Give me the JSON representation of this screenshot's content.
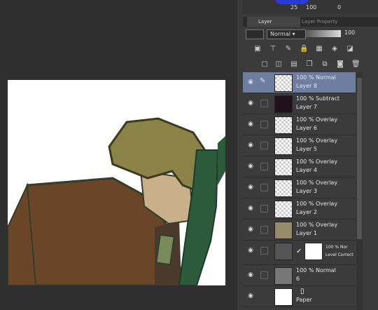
{
  "top": {
    "zoom": "25",
    "value2": "100",
    "value3": "0"
  },
  "tabs": {
    "layer": "Layer",
    "layer_property": "Layer Property"
  },
  "blend": {
    "mode": "Normal",
    "opacity": "100"
  },
  "layers": [
    {
      "pct": "100 % Normal",
      "name": "Layer 8",
      "thumb": "checker",
      "selected": true
    },
    {
      "pct": "100 % Subtract",
      "name": "Layer 7",
      "thumb": "#22111c"
    },
    {
      "pct": "100 % Overlay",
      "name": "Layer 6",
      "thumb": "checker"
    },
    {
      "pct": "100 % Overlay",
      "name": "Layer 5",
      "thumb": "checker"
    },
    {
      "pct": "100 % Overlay",
      "name": "Layer 4",
      "thumb": "checker"
    },
    {
      "pct": "100 % Overlay",
      "name": "Layer 3",
      "thumb": "checker"
    },
    {
      "pct": "100 % Overlay",
      "name": "Layer 2",
      "thumb": "checker"
    },
    {
      "pct": "100 % Overlay",
      "name": "Layer 1",
      "thumb": "#978b6c"
    },
    {
      "pct": "100 % Nor",
      "name": "Level Correct",
      "thumb": "#555"
    },
    {
      "pct": "100 % Normal",
      "name": "6",
      "thumb": "#777"
    },
    {
      "pct": "",
      "name": "Paper",
      "thumb": "#ffffff"
    }
  ],
  "colors": {
    "selected": "#6d7ea0",
    "panel": "#3b3b3b",
    "canvas": "#2f2f2f"
  },
  "icons": [
    "eye-icon",
    "pencil-icon",
    "lock-icon",
    "trash-icon",
    "folder-icon",
    "mask-icon"
  ]
}
